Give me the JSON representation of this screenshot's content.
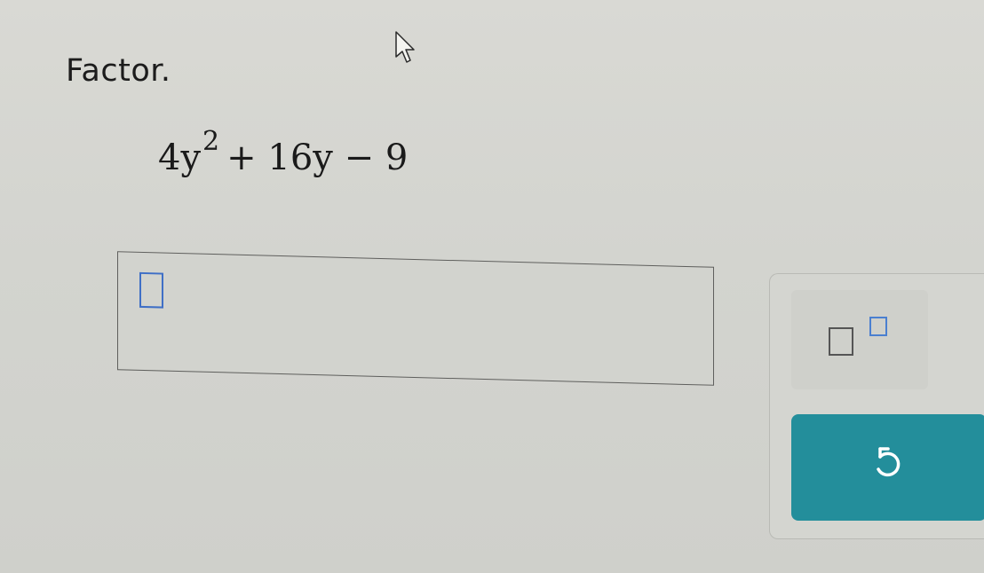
{
  "question": {
    "prompt": "Factor.",
    "expression": {
      "term1_coef_var": "4y",
      "term1_exponent": "2",
      "rest": "+ 16y − 9"
    }
  },
  "answer": {
    "value": ""
  },
  "keypad": {
    "superscript_key": "superscript-template-icon",
    "undo_key": "undo-icon"
  },
  "colors": {
    "accent": "#238e9b",
    "cursor": "#3f6fc6"
  }
}
